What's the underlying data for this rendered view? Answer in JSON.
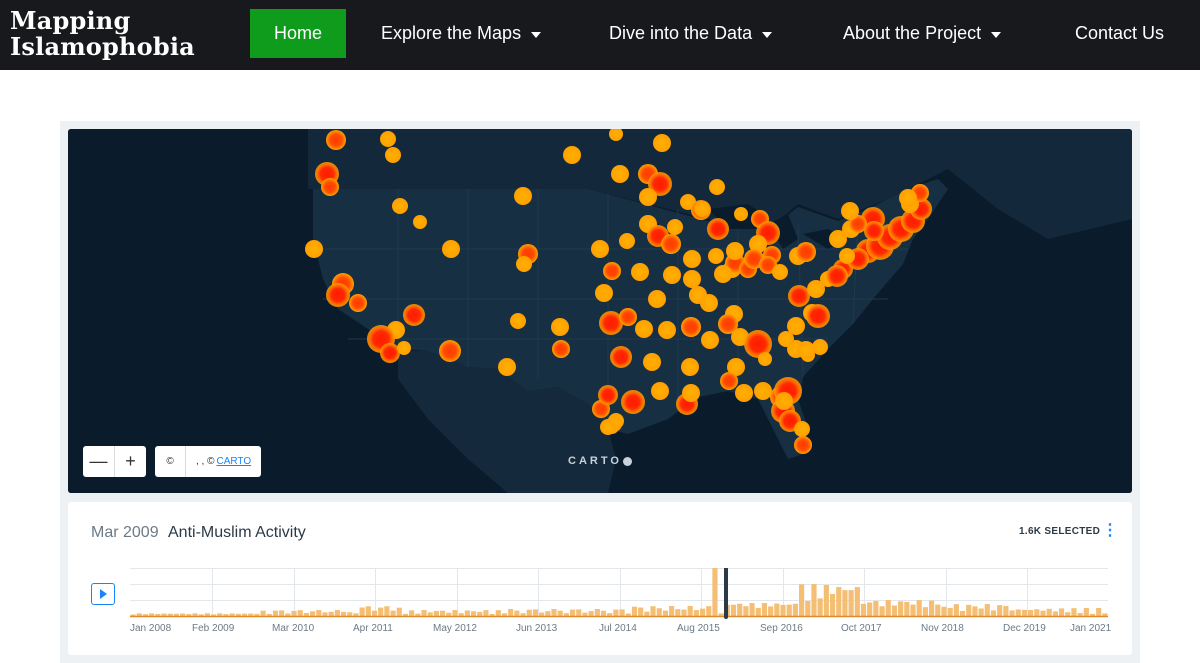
{
  "nav": {
    "logo_line1": "Mapping",
    "logo_line2": "Islamophobia",
    "home": "Home",
    "explore": "Explore the Maps",
    "dive": "Dive into the Data",
    "about": "About the Project",
    "contact": "Contact Us",
    "colors": {
      "bar": "#17191c",
      "home": "#0f9b1c"
    }
  },
  "map": {
    "attribution_symbol": "©",
    "attribution_text": ", , ©",
    "attribution_link": "CARTO",
    "carto_logo": "CARTO",
    "zoom_out": "—",
    "zoom_in": "+"
  },
  "timeline": {
    "current_date": "Mar 2009",
    "title": "Anti-Muslim Activity",
    "selected": "1.6K SELECTED",
    "menu": "⋮",
    "axis_labels": [
      "Jan 2008",
      "Feb 2009",
      "Mar 2010",
      "Apr 2011",
      "May 2012",
      "Jun 2013",
      "Jul 2014",
      "Aug 2015",
      "Sep 2016",
      "Oct 2017",
      "Nov 2018",
      "Dec 2019",
      "Jan 2021"
    ],
    "bar_color": "#f4bf75",
    "accent": "#1785fb"
  }
}
